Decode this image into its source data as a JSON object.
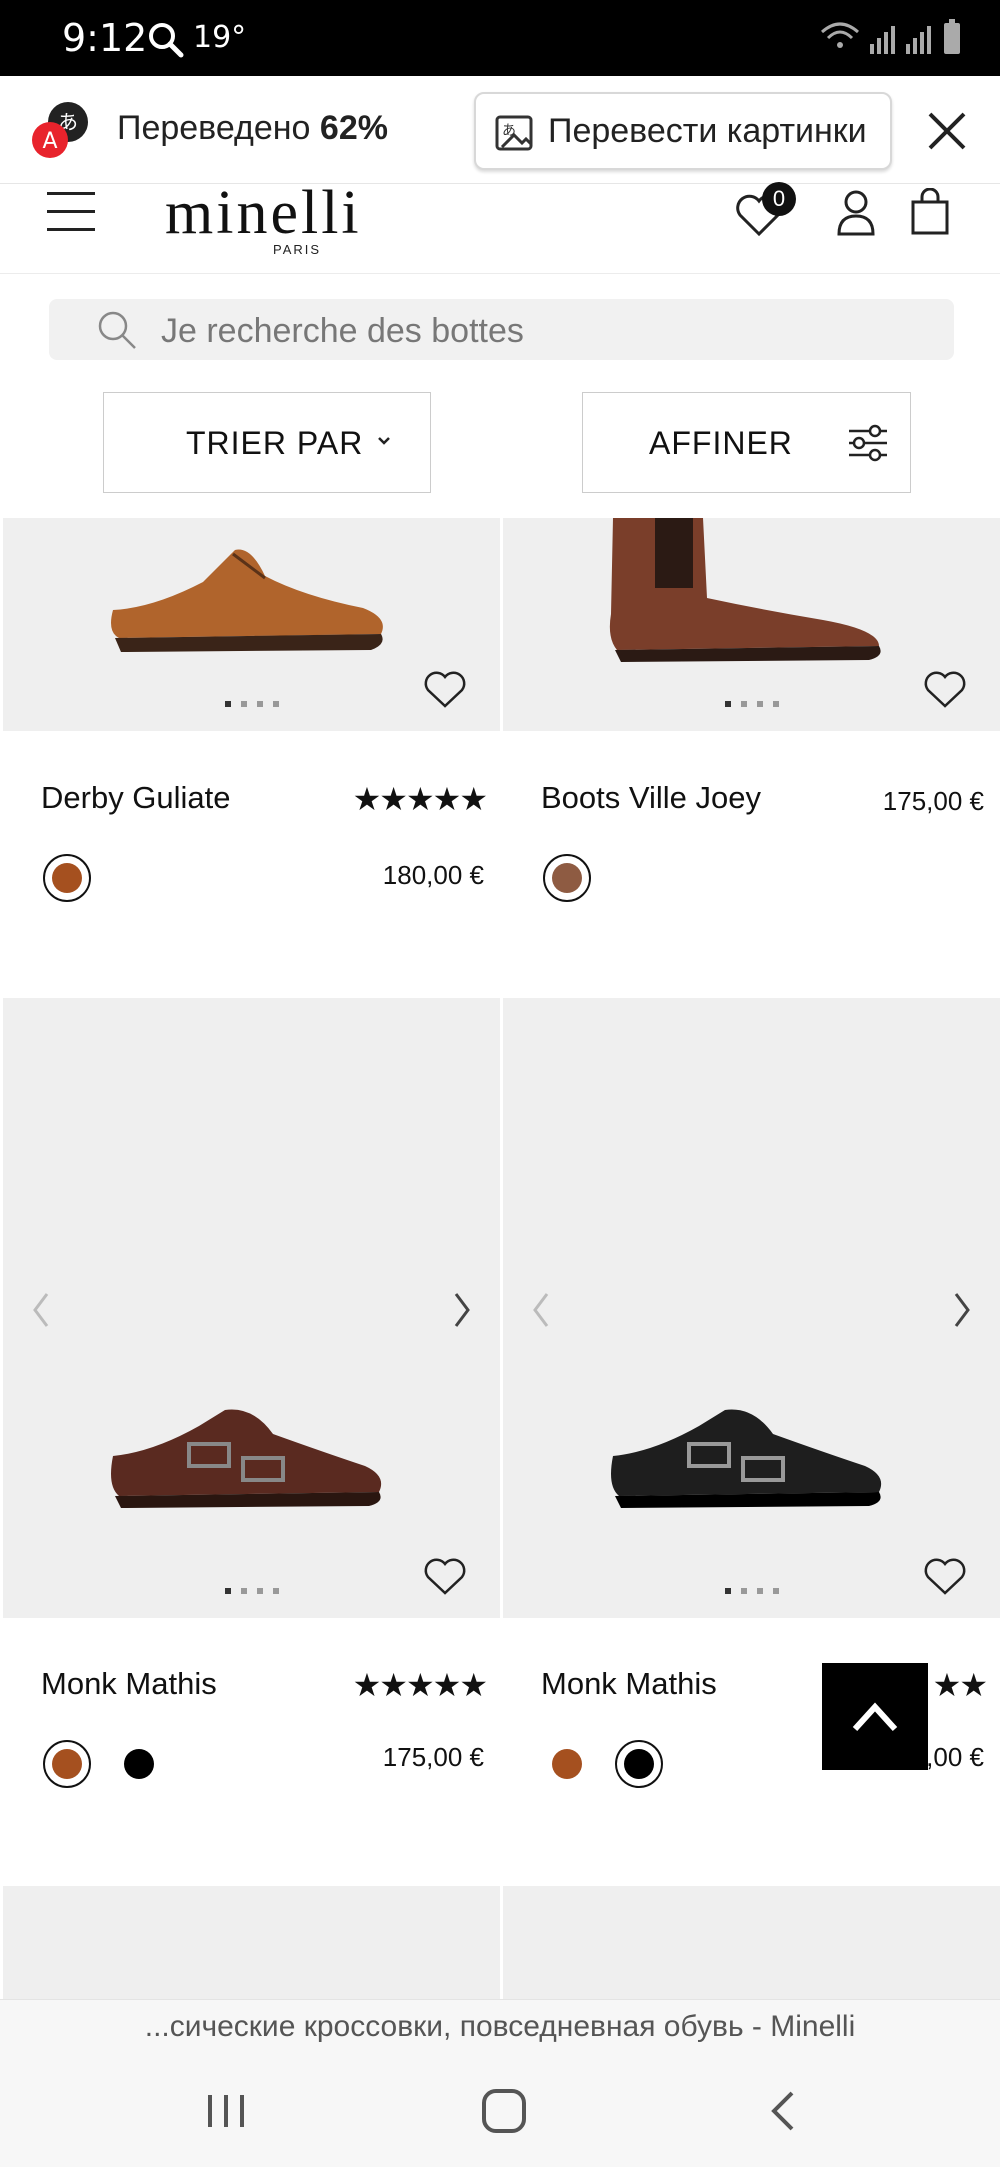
{
  "status_bar": {
    "time": "9:12",
    "temperature": "19°"
  },
  "translate_bar": {
    "status_prefix": "Переведено",
    "status_percent": "62%",
    "images_button": "Перевести картинки"
  },
  "header": {
    "logo": "minelli",
    "logo_sub": "PARIS",
    "wishlist_count": "0"
  },
  "search": {
    "placeholder": "Je recherche des bottes"
  },
  "filters": {
    "sort_label": "TRIER PAR",
    "refine_label": "AFFINER"
  },
  "products": [
    {
      "name": "Derby Guliate",
      "price": "180,00 €",
      "rating": 5,
      "stars": "★★★★★",
      "colors": [
        "#a5501f"
      ],
      "selected_color": 0
    },
    {
      "name": "Boots Ville Joey",
      "price": "175,00 €",
      "colors": [
        "#8e5b42"
      ],
      "selected_color": 0
    },
    {
      "name": "Monk Mathis",
      "price": "175,00 €",
      "rating": 5,
      "stars": "★★★★★",
      "colors": [
        "#a5501f",
        "#000000"
      ],
      "selected_color": 0
    },
    {
      "name": "Monk Mathis",
      "price": ",00 €",
      "rating": 5,
      "stars": "★★",
      "colors": [
        "#a5501f",
        "#000000"
      ],
      "selected_color": 1
    }
  ],
  "page_title": "...сические кроссовки, повседневная обувь - Minelli",
  "icons": {
    "status": [
      "search-icon",
      "wifi-icon",
      "signal-icon",
      "battery-icon"
    ],
    "translate": [
      "translate-app-icon",
      "image-translate-icon",
      "close-icon"
    ],
    "header": [
      "menu-icon",
      "heart-icon",
      "user-icon",
      "bag-icon"
    ],
    "nav": [
      "recents-icon",
      "home-icon",
      "back-icon"
    ]
  }
}
